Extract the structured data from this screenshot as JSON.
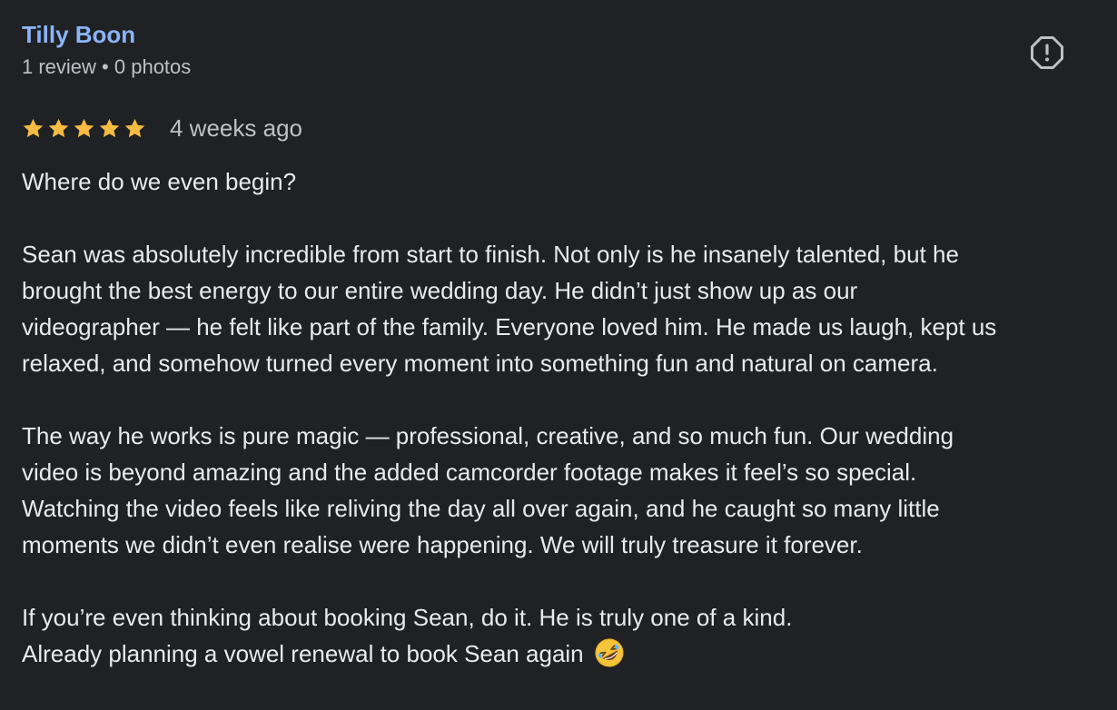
{
  "reviewer": {
    "name": "Tilly Boon",
    "review_count": "1 review",
    "separator": "•",
    "photo_count": "0 photos"
  },
  "rating": {
    "stars": 5,
    "max_stars": 5,
    "date": "4 weeks ago"
  },
  "review": {
    "opening": "Where do we even begin?",
    "paragraph1": [
      "Sean was absolutely incredible from start to finish. Not only is he insanely talented, but he",
      "brought the best energy to our entire wedding day. He didn’t just show up as our",
      "videographer — he felt like part of the family. Everyone loved him. He made us laugh, kept us",
      "relaxed, and somehow turned every moment into something fun and natural on camera."
    ],
    "paragraph2": [
      "The way he works is pure magic — professional, creative, and so much fun. Our wedding",
      "video is beyond amazing and the added camcorder footage makes it feel’s so special.",
      "Watching the video feels like reliving the day all over again, and he caught so many little",
      "moments we didn’t even realise were happening. We will truly treasure it forever."
    ],
    "closing": [
      "If you’re even thinking about booking Sean, do it. He is truly one of a kind.",
      "Already planning a vowel renewal to book Sean again"
    ],
    "emoji": "rolling-on-floor-laughing-emoji"
  },
  "icons": {
    "report": "report-flag-icon",
    "star": "star-icon"
  },
  "colors": {
    "background": "#202124",
    "name_link": "#8ab4f8",
    "star": "#f6bb42",
    "text": "#e8eaed",
    "muted": "#bdc1c6"
  }
}
